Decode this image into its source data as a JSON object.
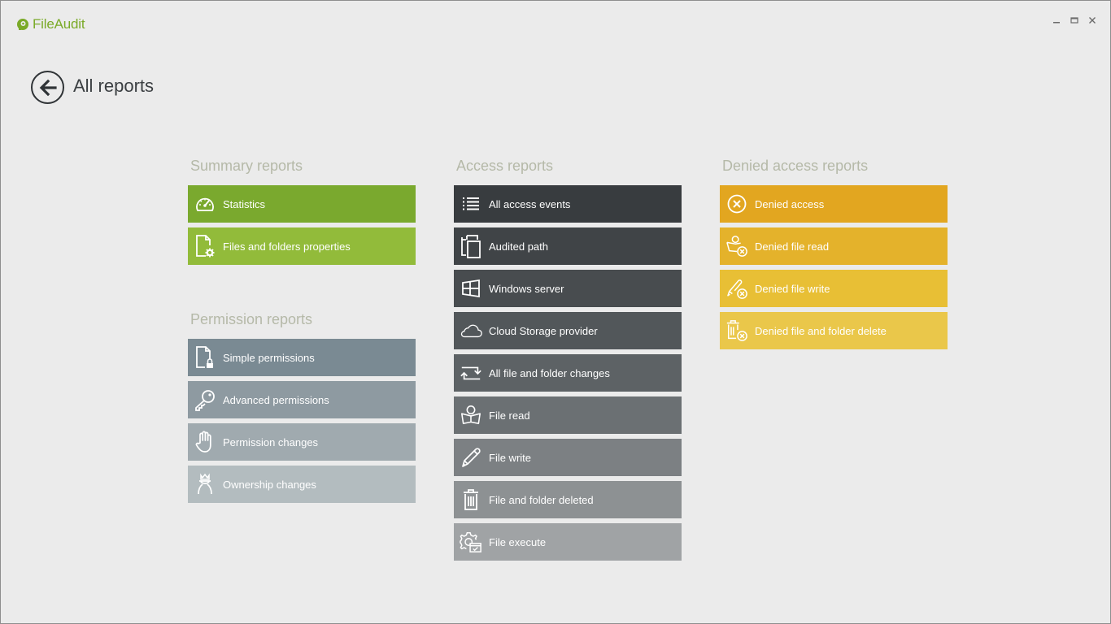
{
  "app": {
    "name": "FileAudit",
    "brand_color": "#7aaa28",
    "window_controls": [
      "minimize",
      "maximize",
      "close"
    ]
  },
  "header": {
    "back_icon": "arrow-left-circle-icon",
    "title": "All reports"
  },
  "sections": {
    "summary": {
      "title": "Summary reports",
      "items": [
        {
          "label": "Statistics",
          "icon": "speedometer-icon",
          "color": "#7aa92e"
        },
        {
          "label": "Files and folders properties",
          "icon": "file-gear-icon",
          "color": "#92bb3a"
        }
      ]
    },
    "permission": {
      "title": "Permission reports",
      "items": [
        {
          "label": "Simple permissions",
          "icon": "file-lock-icon",
          "color": "#7a8a93"
        },
        {
          "label": "Advanced permissions",
          "icon": "key-icon",
          "color": "#8e9aa1"
        },
        {
          "label": "Permission changes",
          "icon": "hand-icon",
          "color": "#a0aaaf"
        },
        {
          "label": "Ownership changes",
          "icon": "owner-crown-icon",
          "color": "#b3bcbf"
        }
      ]
    },
    "access": {
      "title": "Access reports",
      "items": [
        {
          "label": "All access events",
          "icon": "list-icon",
          "color": "#383c3f"
        },
        {
          "label": "Audited path",
          "icon": "copy-files-icon",
          "color": "#404447"
        },
        {
          "label": "Windows server",
          "icon": "windows-icon",
          "color": "#484c4f"
        },
        {
          "label": "Cloud Storage provider",
          "icon": "cloud-icon",
          "color": "#52575a"
        },
        {
          "label": "All file and folder changes",
          "icon": "sync-arrows-icon",
          "color": "#5d6265"
        },
        {
          "label": "File read",
          "icon": "reader-book-icon",
          "color": "#6b7073"
        },
        {
          "label": "File write",
          "icon": "pencil-icon",
          "color": "#7c8083"
        },
        {
          "label": "File and folder deleted",
          "icon": "trash-icon",
          "color": "#8d9193"
        },
        {
          "label": "File execute",
          "icon": "gear-window-icon",
          "color": "#a0a3a5"
        }
      ]
    },
    "denied": {
      "title": "Denied access reports",
      "items": [
        {
          "label": "Denied access",
          "icon": "x-circle-icon",
          "color": "#e2a620"
        },
        {
          "label": "Denied file read",
          "icon": "denied-read-icon",
          "color": "#e4b22b"
        },
        {
          "label": "Denied file write",
          "icon": "denied-write-icon",
          "color": "#e8bf35"
        },
        {
          "label": "Denied file and folder delete",
          "icon": "denied-delete-icon",
          "color": "#eac74a"
        }
      ]
    }
  }
}
